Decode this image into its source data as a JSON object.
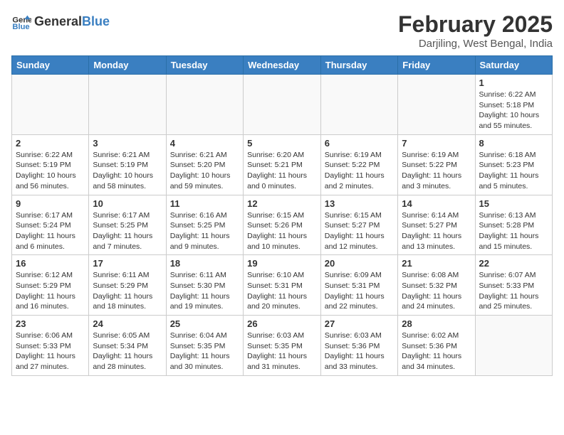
{
  "header": {
    "logo_general": "General",
    "logo_blue": "Blue",
    "title": "February 2025",
    "location": "Darjiling, West Bengal, India"
  },
  "weekdays": [
    "Sunday",
    "Monday",
    "Tuesday",
    "Wednesday",
    "Thursday",
    "Friday",
    "Saturday"
  ],
  "weeks": [
    [
      {
        "day": "",
        "info": ""
      },
      {
        "day": "",
        "info": ""
      },
      {
        "day": "",
        "info": ""
      },
      {
        "day": "",
        "info": ""
      },
      {
        "day": "",
        "info": ""
      },
      {
        "day": "",
        "info": ""
      },
      {
        "day": "1",
        "info": "Sunrise: 6:22 AM\nSunset: 5:18 PM\nDaylight: 10 hours\nand 55 minutes."
      }
    ],
    [
      {
        "day": "2",
        "info": "Sunrise: 6:22 AM\nSunset: 5:19 PM\nDaylight: 10 hours\nand 56 minutes."
      },
      {
        "day": "3",
        "info": "Sunrise: 6:21 AM\nSunset: 5:19 PM\nDaylight: 10 hours\nand 58 minutes."
      },
      {
        "day": "4",
        "info": "Sunrise: 6:21 AM\nSunset: 5:20 PM\nDaylight: 10 hours\nand 59 minutes."
      },
      {
        "day": "5",
        "info": "Sunrise: 6:20 AM\nSunset: 5:21 PM\nDaylight: 11 hours\nand 0 minutes."
      },
      {
        "day": "6",
        "info": "Sunrise: 6:19 AM\nSunset: 5:22 PM\nDaylight: 11 hours\nand 2 minutes."
      },
      {
        "day": "7",
        "info": "Sunrise: 6:19 AM\nSunset: 5:22 PM\nDaylight: 11 hours\nand 3 minutes."
      },
      {
        "day": "8",
        "info": "Sunrise: 6:18 AM\nSunset: 5:23 PM\nDaylight: 11 hours\nand 5 minutes."
      }
    ],
    [
      {
        "day": "9",
        "info": "Sunrise: 6:17 AM\nSunset: 5:24 PM\nDaylight: 11 hours\nand 6 minutes."
      },
      {
        "day": "10",
        "info": "Sunrise: 6:17 AM\nSunset: 5:25 PM\nDaylight: 11 hours\nand 7 minutes."
      },
      {
        "day": "11",
        "info": "Sunrise: 6:16 AM\nSunset: 5:25 PM\nDaylight: 11 hours\nand 9 minutes."
      },
      {
        "day": "12",
        "info": "Sunrise: 6:15 AM\nSunset: 5:26 PM\nDaylight: 11 hours\nand 10 minutes."
      },
      {
        "day": "13",
        "info": "Sunrise: 6:15 AM\nSunset: 5:27 PM\nDaylight: 11 hours\nand 12 minutes."
      },
      {
        "day": "14",
        "info": "Sunrise: 6:14 AM\nSunset: 5:27 PM\nDaylight: 11 hours\nand 13 minutes."
      },
      {
        "day": "15",
        "info": "Sunrise: 6:13 AM\nSunset: 5:28 PM\nDaylight: 11 hours\nand 15 minutes."
      }
    ],
    [
      {
        "day": "16",
        "info": "Sunrise: 6:12 AM\nSunset: 5:29 PM\nDaylight: 11 hours\nand 16 minutes."
      },
      {
        "day": "17",
        "info": "Sunrise: 6:11 AM\nSunset: 5:29 PM\nDaylight: 11 hours\nand 18 minutes."
      },
      {
        "day": "18",
        "info": "Sunrise: 6:11 AM\nSunset: 5:30 PM\nDaylight: 11 hours\nand 19 minutes."
      },
      {
        "day": "19",
        "info": "Sunrise: 6:10 AM\nSunset: 5:31 PM\nDaylight: 11 hours\nand 20 minutes."
      },
      {
        "day": "20",
        "info": "Sunrise: 6:09 AM\nSunset: 5:31 PM\nDaylight: 11 hours\nand 22 minutes."
      },
      {
        "day": "21",
        "info": "Sunrise: 6:08 AM\nSunset: 5:32 PM\nDaylight: 11 hours\nand 24 minutes."
      },
      {
        "day": "22",
        "info": "Sunrise: 6:07 AM\nSunset: 5:33 PM\nDaylight: 11 hours\nand 25 minutes."
      }
    ],
    [
      {
        "day": "23",
        "info": "Sunrise: 6:06 AM\nSunset: 5:33 PM\nDaylight: 11 hours\nand 27 minutes."
      },
      {
        "day": "24",
        "info": "Sunrise: 6:05 AM\nSunset: 5:34 PM\nDaylight: 11 hours\nand 28 minutes."
      },
      {
        "day": "25",
        "info": "Sunrise: 6:04 AM\nSunset: 5:35 PM\nDaylight: 11 hours\nand 30 minutes."
      },
      {
        "day": "26",
        "info": "Sunrise: 6:03 AM\nSunset: 5:35 PM\nDaylight: 11 hours\nand 31 minutes."
      },
      {
        "day": "27",
        "info": "Sunrise: 6:03 AM\nSunset: 5:36 PM\nDaylight: 11 hours\nand 33 minutes."
      },
      {
        "day": "28",
        "info": "Sunrise: 6:02 AM\nSunset: 5:36 PM\nDaylight: 11 hours\nand 34 minutes."
      },
      {
        "day": "",
        "info": ""
      }
    ]
  ]
}
